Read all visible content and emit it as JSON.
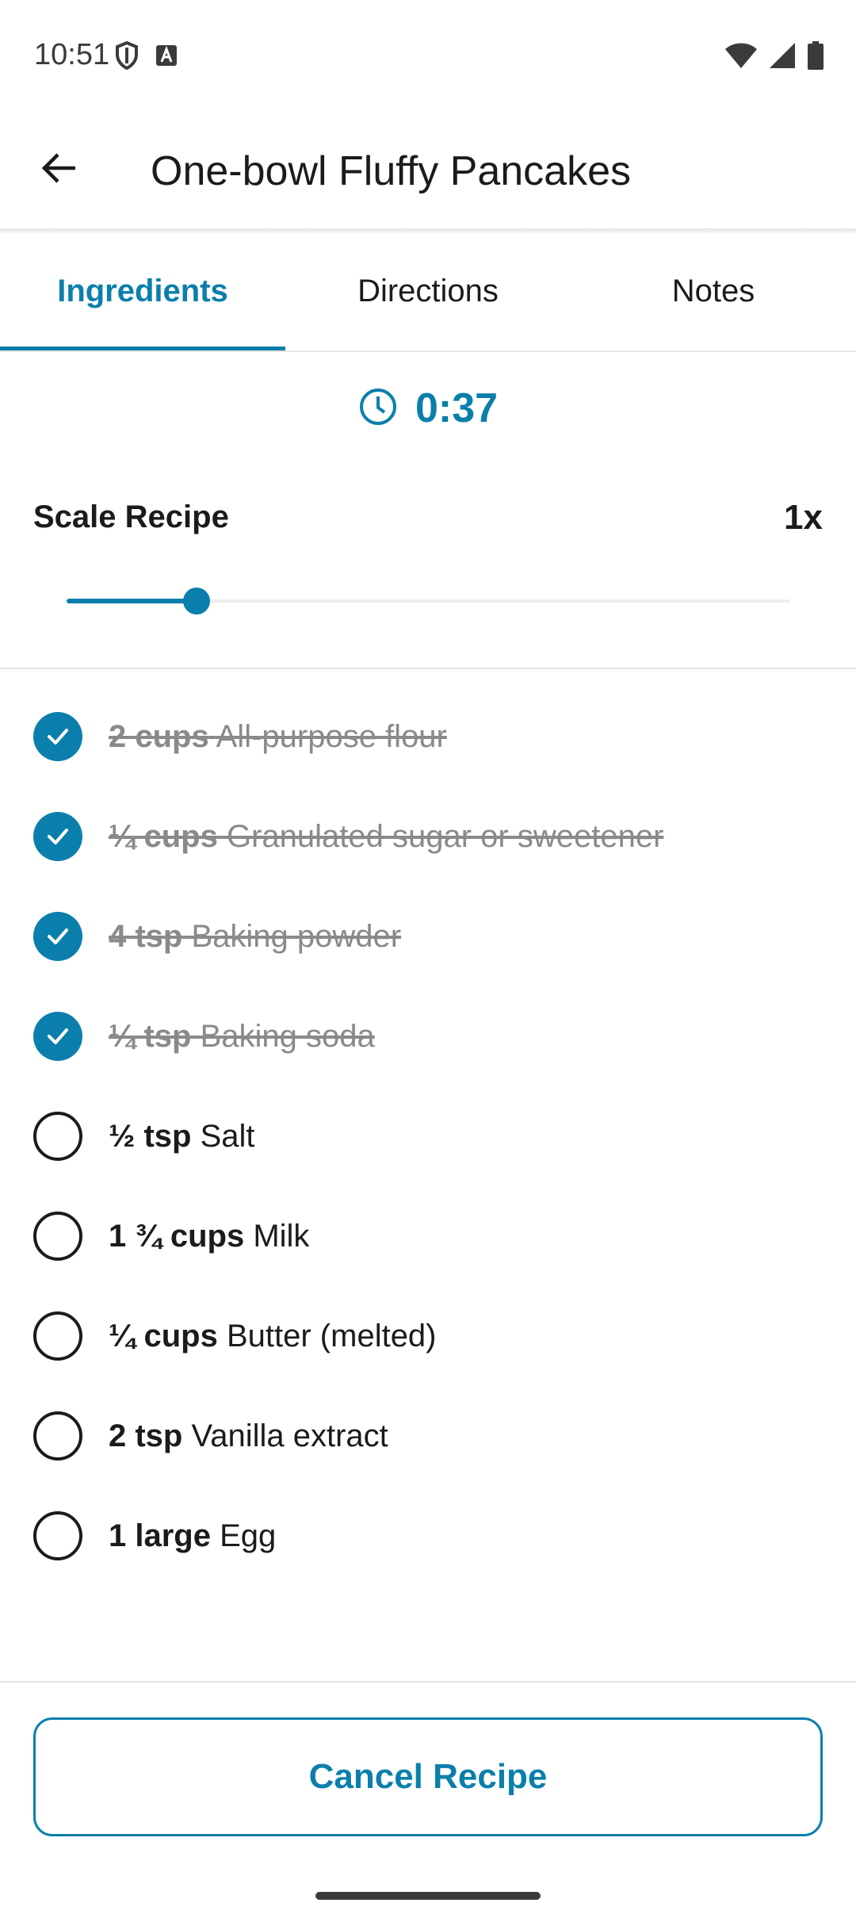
{
  "status_bar": {
    "time": "10:51",
    "icons": [
      "shield-icon",
      "keyboard-a-icon",
      "wifi-icon",
      "signal-icon",
      "battery-icon"
    ]
  },
  "app_bar": {
    "title": "One-bowl Fluffy Pancakes",
    "back_icon": "arrow-back-icon"
  },
  "tabs": [
    {
      "label": "Ingredients",
      "active": true
    },
    {
      "label": "Directions",
      "active": false
    },
    {
      "label": "Notes",
      "active": false
    }
  ],
  "timer": {
    "icon": "clock-icon",
    "value": "0:37"
  },
  "scale": {
    "label": "Scale Recipe",
    "value": "1x",
    "slider_fraction": 0.18
  },
  "ingredients": [
    {
      "qty": "2 cups",
      "name": "All-purpose flour",
      "checked": true
    },
    {
      "qty": "¼ cups",
      "name": "Granulated sugar or sweetener",
      "checked": true
    },
    {
      "qty": "4 tsp",
      "name": "Baking powder",
      "checked": true
    },
    {
      "qty": "¼ tsp",
      "name": "Baking soda",
      "checked": true
    },
    {
      "qty": "½ tsp",
      "name": "Salt",
      "checked": false
    },
    {
      "qty": "1 ¾ cups",
      "name": "Milk",
      "checked": false
    },
    {
      "qty": "¼ cups",
      "name": "Butter (melted)",
      "checked": false
    },
    {
      "qty": "2 tsp",
      "name": "Vanilla extract",
      "checked": false
    },
    {
      "qty": "1 large",
      "name": "Egg",
      "checked": false
    }
  ],
  "footer": {
    "cancel_label": "Cancel Recipe"
  },
  "colors": {
    "accent": "#0b7fab",
    "text": "#1b1b1b",
    "muted": "#8a8a8a"
  }
}
